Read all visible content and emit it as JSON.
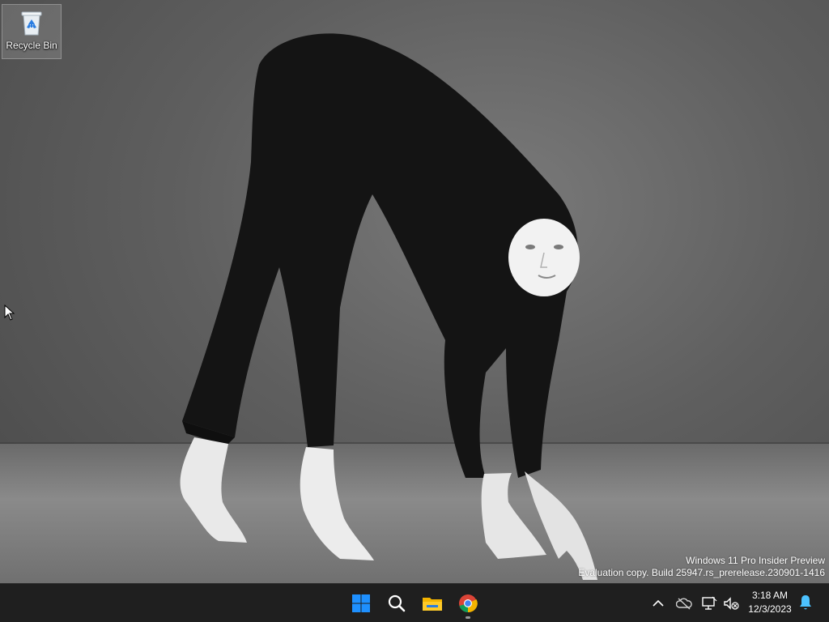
{
  "desktop": {
    "icons": [
      {
        "label": "Recycle Bin",
        "icon": "recycle-bin-icon"
      }
    ],
    "watermark": {
      "line1": "Windows 11 Pro Insider Preview",
      "line2": "Evaluation copy. Build 25947.rs_prerelease.230901-1416"
    }
  },
  "taskbar": {
    "background": "#1f1f1f",
    "pinned": [
      {
        "name": "start",
        "icon": "windows-logo-icon"
      },
      {
        "name": "search",
        "icon": "search-icon"
      },
      {
        "name": "file-explorer",
        "icon": "folder-icon"
      },
      {
        "name": "chrome",
        "icon": "chrome-icon"
      }
    ],
    "tray": {
      "icons": [
        "chevron-up-icon",
        "onedrive-offline-icon",
        "network-icon",
        "volume-muted-icon"
      ],
      "time": "3:18 AM",
      "date": "12/3/2023",
      "notification_icon": "bell-icon"
    }
  },
  "colors": {
    "windows_blue": "#1e90ff",
    "accent": "#4cc2ff"
  }
}
